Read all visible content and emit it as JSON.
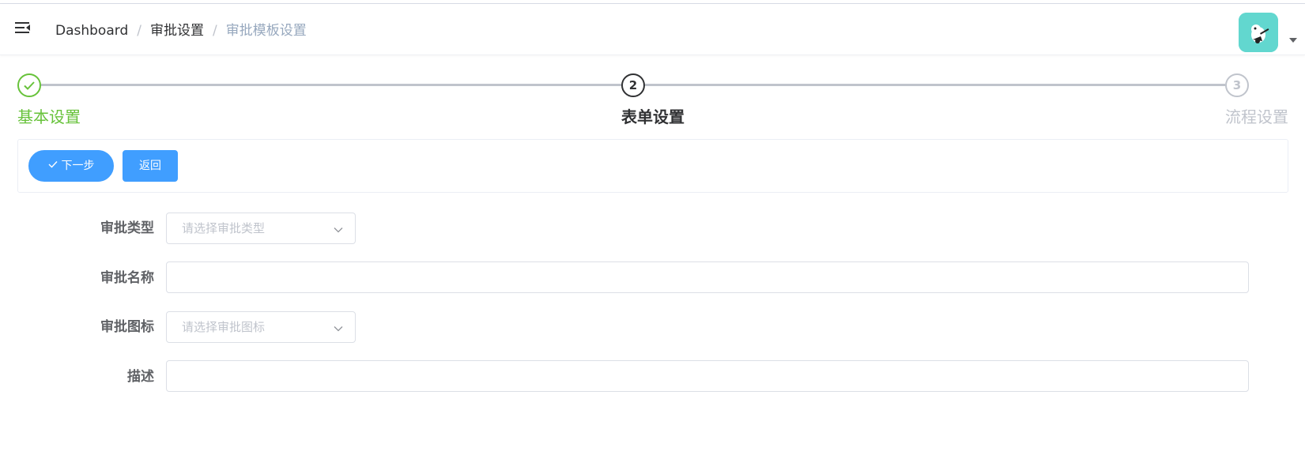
{
  "breadcrumb": {
    "items": [
      "Dashboard",
      "审批设置",
      "审批模板设置"
    ],
    "separator": "/"
  },
  "steps": [
    {
      "title": "基本设置",
      "status": "success",
      "number": "1"
    },
    {
      "title": "表单设置",
      "status": "process",
      "number": "2"
    },
    {
      "title": "流程设置",
      "status": "wait",
      "number": "3"
    }
  ],
  "toolbar": {
    "next_label": "下一步",
    "back_label": "返回"
  },
  "form": {
    "type_label": "审批类型",
    "type_placeholder": "请选择审批类型",
    "name_label": "审批名称",
    "name_value": "",
    "icon_label": "审批图标",
    "icon_placeholder": "请选择审批图标",
    "desc_label": "描述",
    "desc_value": ""
  },
  "colors": {
    "primary": "#409eff",
    "success": "#67c23a",
    "avatar_bg": "#62d7cf",
    "text_muted": "#97a8be"
  },
  "icons": {
    "menu": "hamburger-icon",
    "avatar": "user-avatar-icon",
    "caret": "caret-down-icon",
    "check": "check-icon",
    "select_arrow": "chevron-down-icon"
  }
}
